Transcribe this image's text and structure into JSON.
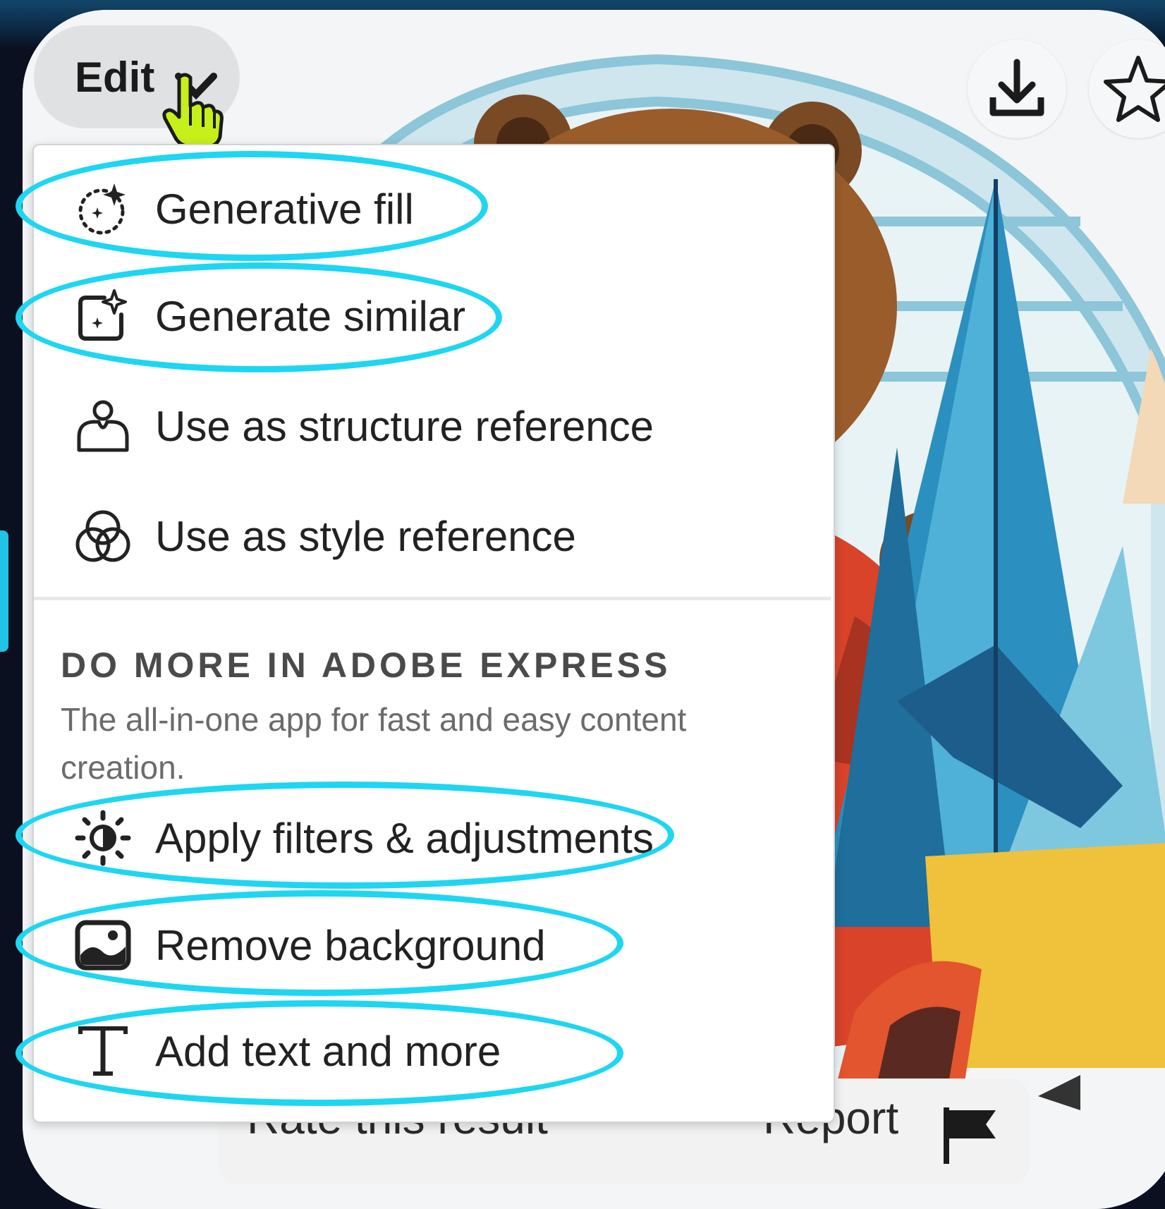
{
  "toolbar": {
    "edit_label": "Edit"
  },
  "menu": {
    "items": [
      {
        "label": "Generative fill",
        "icon": "generative-fill-icon"
      },
      {
        "label": "Generate similar",
        "icon": "generate-similar-icon"
      },
      {
        "label": "Use as structure reference",
        "icon": "structure-reference-icon"
      },
      {
        "label": "Use as style reference",
        "icon": "style-reference-icon"
      }
    ],
    "section": {
      "title": "DO MORE IN ADOBE EXPRESS",
      "description": "The all-in-one app for fast and easy content creation."
    },
    "express_items": [
      {
        "label": "Apply filters & adjustments",
        "icon": "filters-adjustments-icon"
      },
      {
        "label": "Remove background",
        "icon": "remove-background-icon"
      },
      {
        "label": "Add text and more",
        "icon": "add-text-icon"
      }
    ]
  },
  "feedback": {
    "rate_label": "Rate this result",
    "report_label": "Report"
  },
  "colors": {
    "highlight": "#1ed6f2",
    "menu_bg": "#ffffff",
    "pill_bg": "#dfe1e3"
  }
}
